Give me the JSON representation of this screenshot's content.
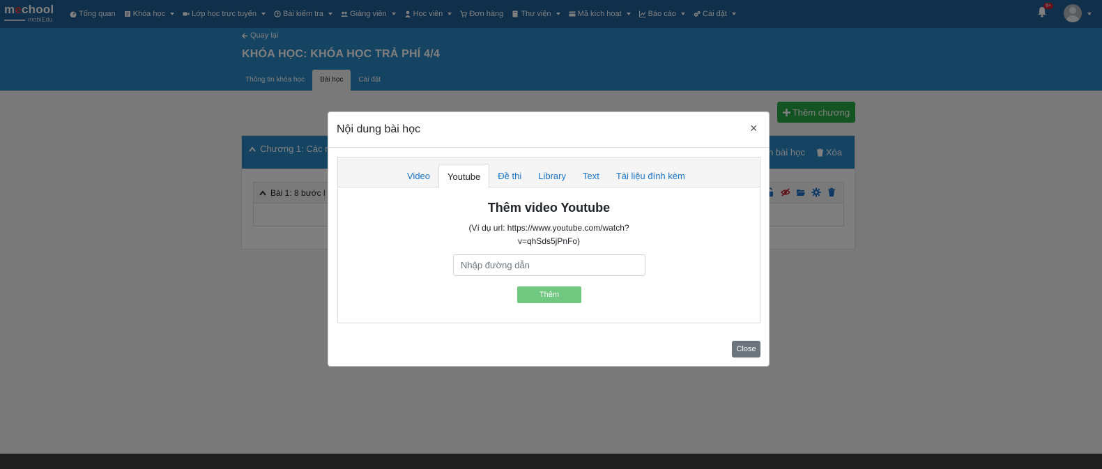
{
  "brand": {
    "logo_main_pre": "m",
    "logo_main_accent": "e",
    "logo_main_post": "chool",
    "logo_sub": "mobiEdu",
    "colors": {
      "navbar": "#1f5f96",
      "header": "#2b86c5",
      "accent_green": "#28a745",
      "link": "#1a73c8",
      "logo_accent": "#e23b3b"
    }
  },
  "navbar": {
    "items": [
      {
        "label": "Tổng quan",
        "icon": "dashboard-icon",
        "dropdown": false
      },
      {
        "label": "Khóa học",
        "icon": "book-icon",
        "dropdown": true
      },
      {
        "label": "Lớp học trực tuyến",
        "icon": "video-camera-icon",
        "dropdown": true
      },
      {
        "label": "Bài kiểm tra",
        "icon": "question-circle-icon",
        "dropdown": true
      },
      {
        "label": "Giảng viên",
        "icon": "users-icon",
        "dropdown": true
      },
      {
        "label": "Học viên",
        "icon": "user-icon",
        "dropdown": true
      },
      {
        "label": "Đơn hàng",
        "icon": "cart-icon",
        "dropdown": false
      },
      {
        "label": "Thư viện",
        "icon": "library-icon",
        "dropdown": true
      },
      {
        "label": "Mã kích hoạt",
        "icon": "card-icon",
        "dropdown": true
      },
      {
        "label": "Báo cáo",
        "icon": "chart-icon",
        "dropdown": true
      },
      {
        "label": "Cài đặt",
        "icon": "gears-icon",
        "dropdown": true
      }
    ],
    "notification_badge": "9+"
  },
  "header": {
    "back_label": "Quay lại",
    "title": "KHÓA HỌC: KHÓA HỌC TRẢ PHÍ 4/4",
    "tabs": [
      {
        "label": "Thông tin khóa học",
        "active": false
      },
      {
        "label": "Bài học",
        "active": true
      },
      {
        "label": "Cài đặt",
        "active": false
      }
    ]
  },
  "content": {
    "add_chapter_label": "Thêm chương",
    "chapter_title": "Chương 1: Các m",
    "chapter_action_add_lesson": "n bài học",
    "chapter_action_delete": "Xóa",
    "lesson_title": "Bài 1: 8 bước l"
  },
  "modal": {
    "title": "Nội dung bài học",
    "close_symbol": "×",
    "tabs": [
      {
        "label": "Video",
        "active": false
      },
      {
        "label": "Youtube",
        "active": true
      },
      {
        "label": "Đề thi",
        "active": false
      },
      {
        "label": "Library",
        "active": false
      },
      {
        "label": "Text",
        "active": false
      },
      {
        "label": "Tài liệu đính kèm",
        "active": false
      }
    ],
    "youtube": {
      "heading": "Thêm video Youtube",
      "example": "(Ví dụ url: https://www.youtube.com/watch?v=qhSds5jPnFo)",
      "input_placeholder": "Nhập đường dẫn",
      "input_value": "",
      "add_label": "Thêm"
    },
    "close_label": "Close"
  }
}
